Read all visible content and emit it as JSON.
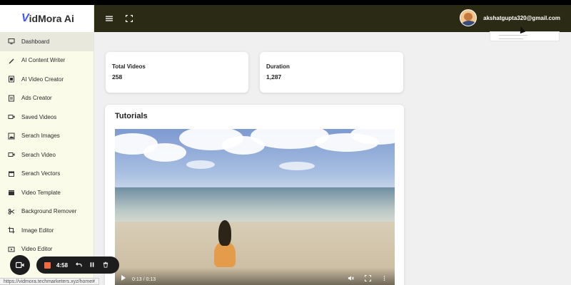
{
  "app": {
    "logo_initial": "V",
    "logo_rest": "idMora Ai"
  },
  "header": {
    "menu_icon": "hamburger-icon",
    "fullscreen_icon": "fullscreen-icon",
    "user_email": "akshatgupta320@gmail.com"
  },
  "sidebar": {
    "items": [
      {
        "label": "Dashboard",
        "icon": "monitor-icon"
      },
      {
        "label": "AI Content Writer",
        "icon": "pen-icon"
      },
      {
        "label": "AI Video Creator",
        "icon": "film-icon"
      },
      {
        "label": "Ads Creator",
        "icon": "ads-icon"
      },
      {
        "label": "Saved Videos",
        "icon": "video-camera-icon"
      },
      {
        "label": "Serach Images",
        "icon": "image-icon"
      },
      {
        "label": "Serach Video",
        "icon": "video-camera-icon"
      },
      {
        "label": "Serach Vectors",
        "icon": "box-icon"
      },
      {
        "label": "Video Template",
        "icon": "clapperboard-icon"
      },
      {
        "label": "Background Remover",
        "icon": "scissors-icon"
      },
      {
        "label": "Image Editor",
        "icon": "crop-icon"
      },
      {
        "label": "Video Editor",
        "icon": "video-edit-icon"
      }
    ]
  },
  "stats": {
    "total_videos_label": "Total Videos",
    "total_videos_value": "258",
    "duration_label": "Duration",
    "duration_value": "1,287"
  },
  "tutorials": {
    "title": "Tutorials",
    "video_time": "0:13 / 0:13",
    "progress": 1.0
  },
  "recorder": {
    "time": "4:58"
  },
  "statusbar": {
    "url": "https://vidmora.techmarketers.xyz/home#"
  },
  "colors": {
    "header_bg": "#2b2a14",
    "sidebar_bg": "#fafbe9",
    "logo_accent": "#3f57ff",
    "record_stop": "#f16a40"
  }
}
